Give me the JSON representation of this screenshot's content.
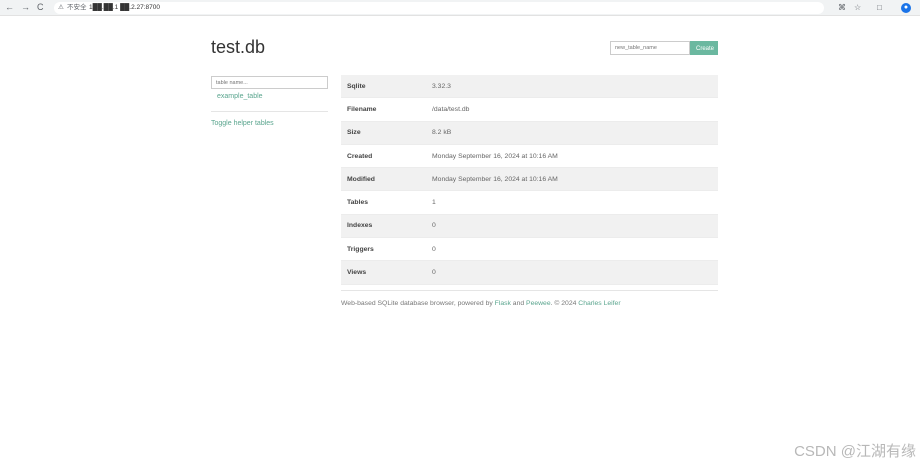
{
  "browser": {
    "back_icon": "←",
    "forward_icon": "→",
    "reload_icon": "C",
    "warning_icon": "⚠",
    "security_label": "不安全",
    "url": "1██.██.1 ██.2.27:8700",
    "translate_icon": "⌘",
    "star_icon": "☆",
    "extensions_icon": "□",
    "profile_icon": "●"
  },
  "page": {
    "title": "test.db"
  },
  "header": {
    "new_table_placeholder": "new_table_name",
    "create_label": "Create"
  },
  "sidebar": {
    "search_placeholder": "table name...",
    "tables": [
      "example_table"
    ],
    "toggle_label": "Toggle helper tables"
  },
  "info_table": {
    "rows": [
      {
        "label": "Sqlite",
        "value": "3.32.3"
      },
      {
        "label": "Filename",
        "value": "/data/test.db"
      },
      {
        "label": "Size",
        "value": "8.2 kB"
      },
      {
        "label": "Created",
        "value": "Monday September 16, 2024 at 10:16 AM"
      },
      {
        "label": "Modified",
        "value": "Monday September 16, 2024 at 10:16 AM"
      },
      {
        "label": "Tables",
        "value": "1"
      },
      {
        "label": "Indexes",
        "value": "0"
      },
      {
        "label": "Triggers",
        "value": "0"
      },
      {
        "label": "Views",
        "value": "0"
      }
    ]
  },
  "footer": {
    "prefix": "Web-based SQLite database browser, powered by ",
    "flask": "Flask",
    "and": " and ",
    "peewee": "Peewee",
    "copyright": ". © 2024 ",
    "author": "Charles Leifer"
  },
  "watermark": "CSDN @江湖有缘"
}
